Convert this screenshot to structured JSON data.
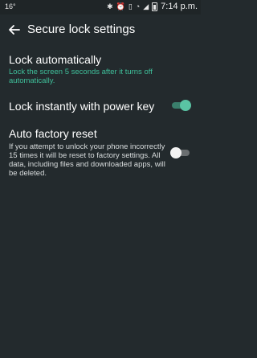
{
  "status_bar": {
    "temperature": "16°",
    "time": "7:14 p.m.",
    "icons": [
      "bluetooth-icon",
      "alarm-icon",
      "vibrate-icon",
      "wifi-icon",
      "signal-icon",
      "battery-icon"
    ]
  },
  "app_bar": {
    "title": "Secure lock settings",
    "back_icon": "back-arrow-icon"
  },
  "settings": {
    "lock_automatically": {
      "title": "Lock automatically",
      "summary": "Lock the screen 5 seconds after it turns off automatically."
    },
    "lock_instantly": {
      "title": "Lock instantly with power key",
      "enabled": true
    },
    "auto_factory_reset": {
      "title": "Auto factory reset",
      "summary": "If you attempt to unlock your phone incorrectly 15 times it will be reset to factory settings. All data, including files and downloaded apps, will be deleted.",
      "enabled": false
    }
  },
  "colors": {
    "background": "#232a2d",
    "accent": "#3fbf9a",
    "toggle_on_thumb": "#5ac4a4",
    "toggle_off_thumb": "#f3f3f3"
  }
}
